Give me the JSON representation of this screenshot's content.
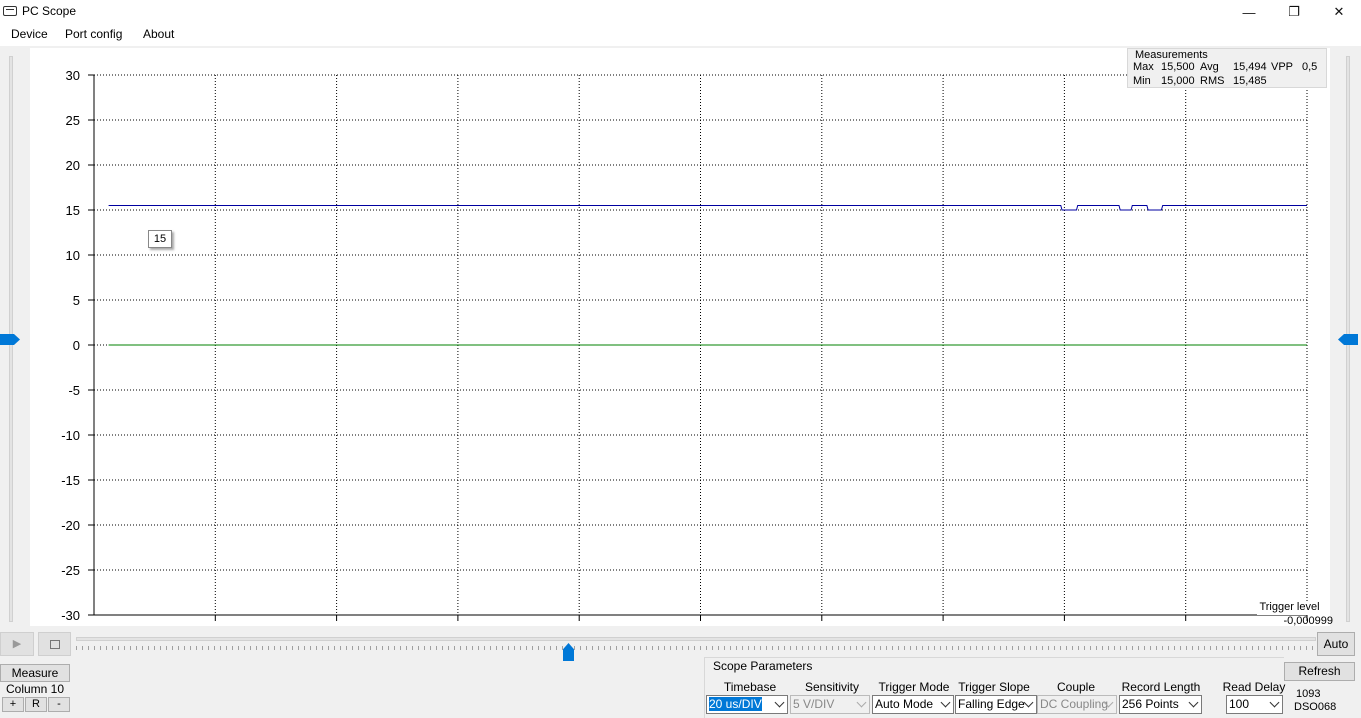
{
  "window": {
    "title": "PC Scope"
  },
  "menu": [
    "Device",
    "Port config",
    "About"
  ],
  "measurements": {
    "title": "Measurements",
    "max_label": "Max",
    "max_value": "15,500",
    "min_label": "Min",
    "min_value": "15,000",
    "avg_label": "Avg",
    "avg_value": "15,494",
    "rms_label": "RMS",
    "rms_value": "15,485",
    "vpp_label": "VPP",
    "vpp_value": "0,5"
  },
  "chart_data": {
    "type": "line",
    "ylim": [
      -30,
      30
    ],
    "yticks": [
      30,
      25,
      20,
      15,
      10,
      5,
      0,
      -5,
      -10,
      -15,
      -20,
      -25,
      -30
    ],
    "x_divisions": 10,
    "grid": true,
    "series": [
      {
        "color": "#0000a0",
        "points": [
          [
            0.12,
            15.5
          ],
          [
            7.97,
            15.5
          ],
          [
            7.98,
            15.0
          ],
          [
            8.1,
            15.0
          ],
          [
            8.11,
            15.5
          ],
          [
            8.45,
            15.5
          ],
          [
            8.46,
            15.0
          ],
          [
            8.55,
            15.0
          ],
          [
            8.56,
            15.5
          ],
          [
            8.68,
            15.5
          ],
          [
            8.69,
            15.0
          ],
          [
            8.8,
            15.0
          ],
          [
            8.81,
            15.5
          ],
          [
            10.0,
            15.5
          ]
        ]
      },
      {
        "color": "#008000",
        "points": [
          [
            0.12,
            0
          ],
          [
            10.0,
            0
          ]
        ]
      }
    ]
  },
  "cursor_value": "15",
  "trigger": {
    "label": "Trigger level",
    "value": "-0,000999"
  },
  "controls": {
    "play": "▶",
    "auto": "Auto",
    "measure": "Measure",
    "column": "Column 10",
    "plus": "+",
    "r": "R",
    "minus": "-",
    "refresh": "Refresh"
  },
  "scope_params": {
    "title": "Scope Parameters",
    "timebase_label": "Timebase",
    "timebase_value": "20 us/DIV",
    "sensitivity_label": "Sensitivity",
    "sensitivity_value": "5 V/DIV",
    "trigger_mode_label": "Trigger Mode",
    "trigger_mode_value": "Auto Mode",
    "trigger_slope_label": "Trigger Slope",
    "trigger_slope_value": "Falling Edge",
    "couple_label": "Couple",
    "couple_value": "DC Coupling",
    "record_length_label": "Record Length",
    "record_length_value": "256 Points",
    "read_delay_label": "Read Delay",
    "read_delay_value": "100"
  },
  "status": {
    "line1": "1093",
    "line2": "DSO068"
  }
}
